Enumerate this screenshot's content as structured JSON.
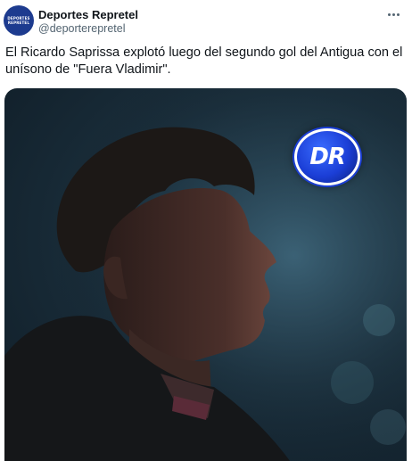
{
  "account": {
    "display_name": "Deportes Repretel",
    "handle": "@deporterepretel",
    "avatar_text": "DEPORTES REPRETEL"
  },
  "tweet": {
    "text": "El Ricardo Saprissa explotó luego del segundo gol del Antigua con el unísono de \"Fuera Vladimir\"."
  },
  "media": {
    "logo_text": "DR",
    "accent_color": "#1b3ed6"
  },
  "icons": {
    "more": "more-options-icon"
  }
}
